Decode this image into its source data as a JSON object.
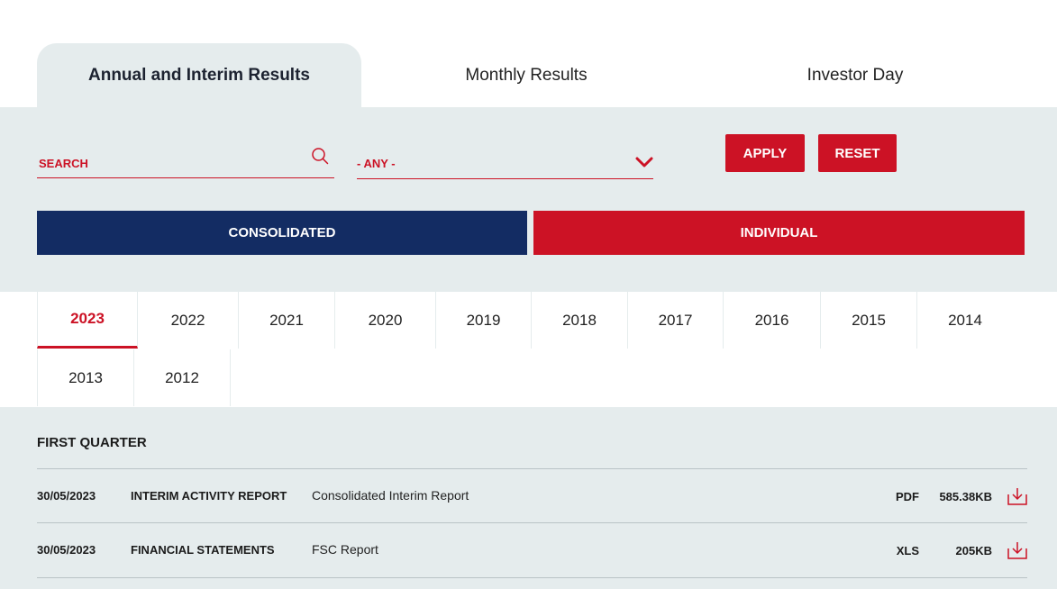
{
  "tabs": [
    {
      "label": "Annual and Interim Results",
      "active": true
    },
    {
      "label": "Monthly Results",
      "active": false
    },
    {
      "label": "Investor Day",
      "active": false
    }
  ],
  "filters": {
    "search_placeholder": "SEARCH",
    "select_value": "- ANY -",
    "apply_label": "APPLY",
    "reset_label": "RESET",
    "consolidated_label": "CONSOLIDATED",
    "individual_label": "INDIVIDUAL"
  },
  "years": [
    "2023",
    "2022",
    "2021",
    "2020",
    "2019",
    "2018",
    "2017",
    "2016",
    "2015",
    "2014",
    "2013",
    "2012"
  ],
  "selected_year": "2023",
  "results": {
    "section_title": "FIRST QUARTER",
    "rows": [
      {
        "date": "30/05/2023",
        "type": "INTERIM ACTIVITY REPORT",
        "description": "Consolidated Interim Report",
        "format": "PDF",
        "size": "585.38KB"
      },
      {
        "date": "30/05/2023",
        "type": "FINANCIAL STATEMENTS",
        "description": "FSC Report",
        "format": "XLS",
        "size": "205KB"
      }
    ]
  },
  "colors": {
    "accent": "#cc1225",
    "navy": "#132c63",
    "panel": "#e5eced"
  },
  "icons": {
    "search": "search-icon",
    "chevron": "chevron-down-icon",
    "download": "download-icon"
  }
}
